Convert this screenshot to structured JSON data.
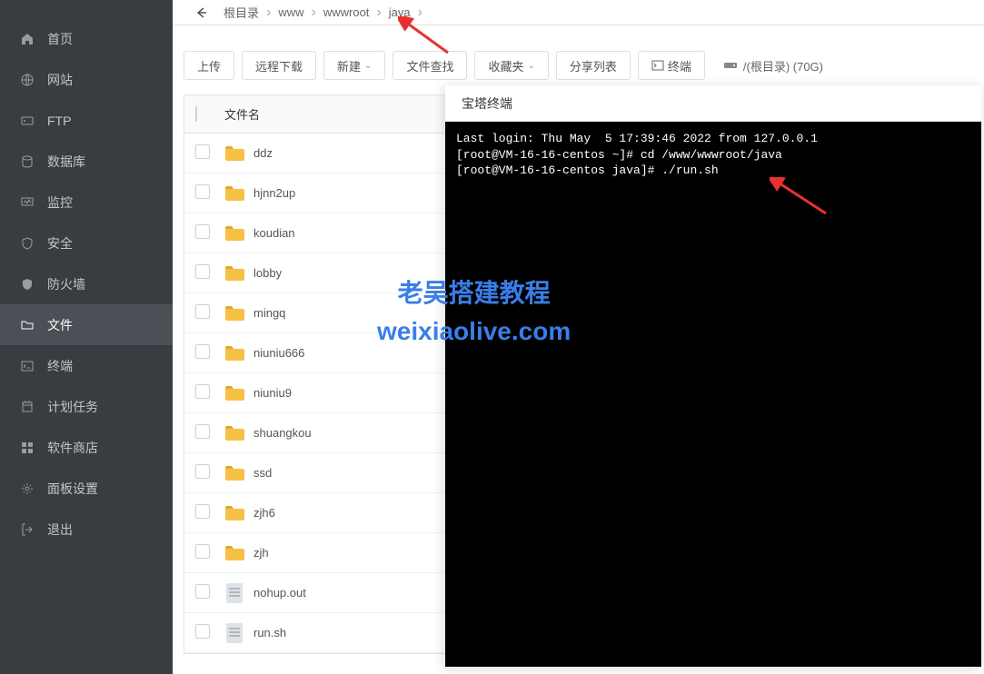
{
  "sidebar": {
    "items": [
      {
        "label": "首页",
        "icon": "home"
      },
      {
        "label": "网站",
        "icon": "globe"
      },
      {
        "label": "FTP",
        "icon": "ftp"
      },
      {
        "label": "数据库",
        "icon": "database"
      },
      {
        "label": "监控",
        "icon": "monitor"
      },
      {
        "label": "安全",
        "icon": "shield"
      },
      {
        "label": "防火墙",
        "icon": "firewall"
      },
      {
        "label": "文件",
        "icon": "folder"
      },
      {
        "label": "终端",
        "icon": "terminal"
      },
      {
        "label": "计划任务",
        "icon": "schedule"
      },
      {
        "label": "软件商店",
        "icon": "apps"
      },
      {
        "label": "面板设置",
        "icon": "settings"
      },
      {
        "label": "退出",
        "icon": "logout"
      }
    ]
  },
  "breadcrumb": [
    "根目录",
    "www",
    "wwwroot",
    "java"
  ],
  "toolbar": {
    "upload": "上传",
    "remote_download": "远程下载",
    "new": "新建",
    "search": "文件查找",
    "favorites": "收藏夹",
    "shared_list": "分享列表",
    "terminal": "终端",
    "disk": "/(根目录) (70G)"
  },
  "table": {
    "header_name": "文件名",
    "files": [
      {
        "name": "ddz",
        "type": "folder"
      },
      {
        "name": "hjnn2up",
        "type": "folder"
      },
      {
        "name": "koudian",
        "type": "folder"
      },
      {
        "name": "lobby",
        "type": "folder"
      },
      {
        "name": "mingq",
        "type": "folder"
      },
      {
        "name": "niuniu666",
        "type": "folder"
      },
      {
        "name": "niuniu9",
        "type": "folder"
      },
      {
        "name": "shuangkou",
        "type": "folder"
      },
      {
        "name": "ssd",
        "type": "folder"
      },
      {
        "name": "zjh6",
        "type": "folder"
      },
      {
        "name": "zjh",
        "type": "folder"
      },
      {
        "name": "nohup.out",
        "type": "file"
      },
      {
        "name": "run.sh",
        "type": "file"
      }
    ]
  },
  "terminal": {
    "title": "宝塔终端",
    "lines": "Last login: Thu May  5 17:39:46 2022 from 127.0.0.1\n[root@VM-16-16-centos ~]# cd /www/wwwroot/java\n[root@VM-16-16-centos java]# ./run.sh"
  },
  "watermark": {
    "line1": "老吴搭建教程",
    "line2": "weixiaolive.com"
  }
}
